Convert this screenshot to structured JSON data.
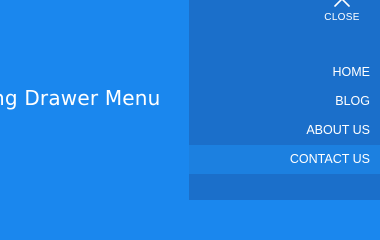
{
  "page": {
    "title": "ng Drawer Menu"
  },
  "drawer": {
    "close_icon": "close-x-icon",
    "close_label": "CLOSE",
    "menu_items": [
      {
        "label": "HOME",
        "active": false
      },
      {
        "label": "BLOG",
        "active": false
      },
      {
        "label": "ABOUT US",
        "active": false
      },
      {
        "label": "CONTACT US",
        "active": true
      }
    ]
  },
  "colors": {
    "page_background": "#1a87ee",
    "drawer_background": "#1b6fca",
    "active_item_background": "#1c80e0",
    "text": "#ffffff"
  }
}
